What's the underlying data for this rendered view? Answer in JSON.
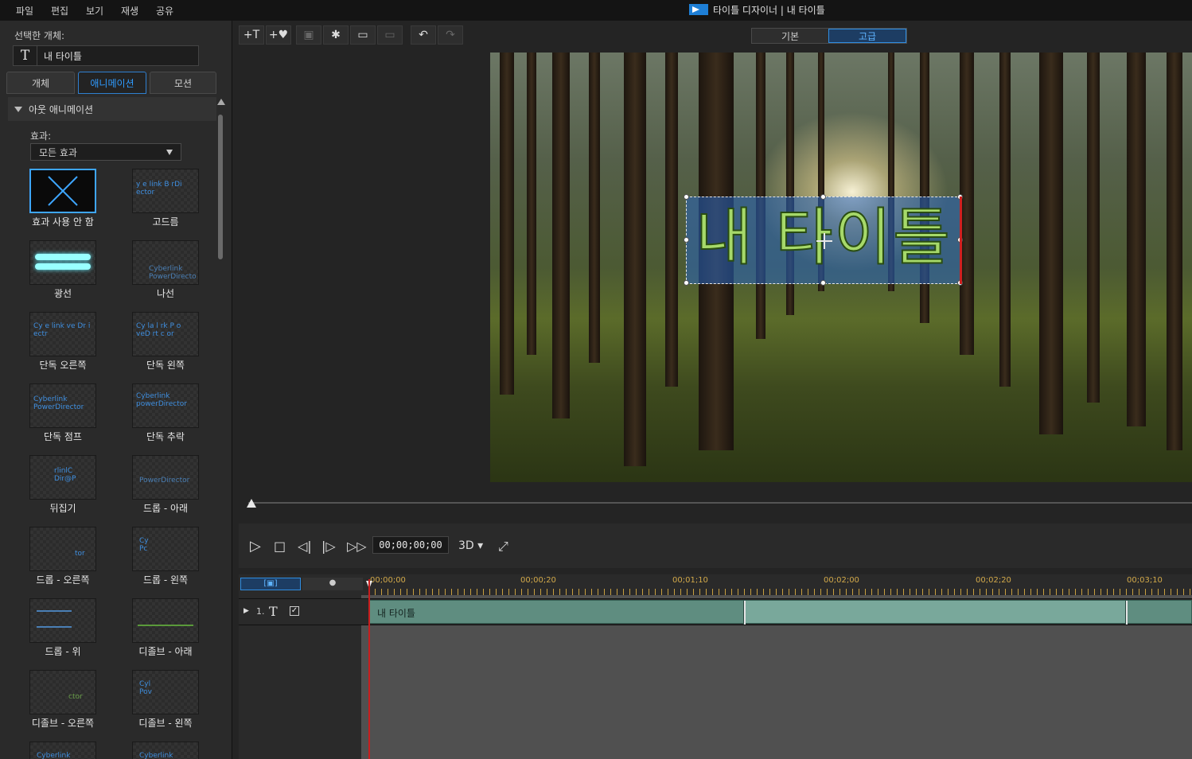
{
  "menu": [
    "파일",
    "편집",
    "보기",
    "재생",
    "공유"
  ],
  "app_title": "타이틀 디자이너 | 내 타이틀",
  "left_panel": {
    "selected_object_label": "선택한 개체:",
    "selected_object_name": "내 타이틀",
    "tabs": [
      "개체",
      "애니메이션",
      "모션"
    ],
    "active_tab": "애니메이션",
    "section_title": "아웃 애니메이션",
    "effect_label": "효과:",
    "effect_select": "모든 효과",
    "effects": [
      {
        "label": "효과 사용 안 함",
        "preview": ""
      },
      {
        "label": "고드름",
        "preview": "y e link  B rDi ector"
      },
      {
        "label": "광선",
        "preview": ""
      },
      {
        "label": "나선",
        "preview": "Cyberlink PowerDirecto"
      },
      {
        "label": "단독 오른쪽",
        "preview": "Cy e link ve Dr i ectr"
      },
      {
        "label": "단독 왼쪽",
        "preview": "Cy la l rk P o veD rt c or"
      },
      {
        "label": "단독 점프",
        "preview": "Cyberlink PowerDirector"
      },
      {
        "label": "단독 추락",
        "preview": "Cyberlink powerDirector"
      },
      {
        "label": "뒤집기",
        "preview": "rlinlC Dir@P"
      },
      {
        "label": "드롭 - 아래",
        "preview": "PowerDirector"
      },
      {
        "label": "드롭 - 오른쪽",
        "preview": "tor"
      },
      {
        "label": "드롭 - 왼쪽",
        "preview": "Cy Pc"
      },
      {
        "label": "드롭 - 위",
        "preview": ""
      },
      {
        "label": "디졸브 - 아래",
        "preview": ""
      },
      {
        "label": "디졸브 - 오른쪽",
        "preview": "ctor"
      },
      {
        "label": "디졸브 - 왼쪽",
        "preview": "Cyl Pov"
      },
      {
        "label": "",
        "preview": "Cyberlink"
      },
      {
        "label": "",
        "preview": "Cyberlink"
      }
    ]
  },
  "toolbar": {
    "buttons": [
      "+T",
      "+♥",
      "▣",
      "✱",
      "▭",
      "▭",
      "↶",
      "↷"
    ],
    "mode_basic": "기본",
    "mode_advanced": "고급"
  },
  "preview": {
    "title_text": "내 타이틀"
  },
  "playback": {
    "timecode": "00;00;00;00",
    "mode_3d": "3D"
  },
  "timeline": {
    "ruler_labels": [
      "00;00;00",
      "00;00;20",
      "00;01;10",
      "00;02;00",
      "00;02;20",
      "00;03;10"
    ],
    "track_number": "1.",
    "track_type_icon": "T",
    "clip_label": "내 타이틀"
  },
  "colors": {
    "accent": "#2f9bff",
    "clip": "#5f8d80",
    "playhead": "#c81d1d",
    "title_fill": "#a6d96a"
  }
}
